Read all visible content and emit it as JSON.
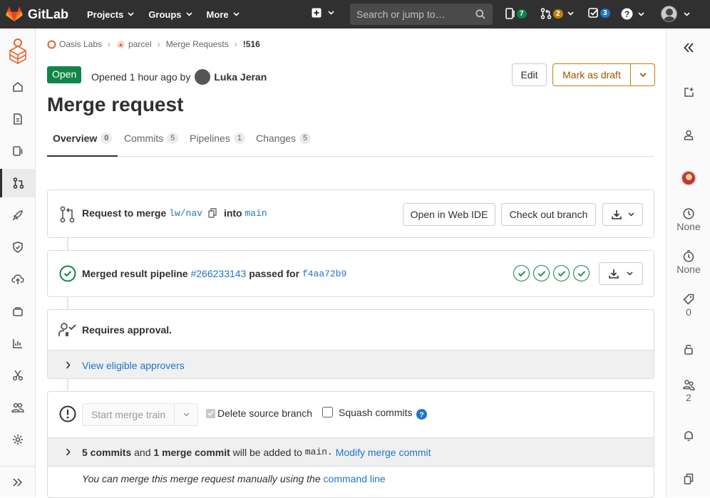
{
  "topbar": {
    "brand": "GitLab",
    "nav": [
      "Projects",
      "Groups",
      "More"
    ],
    "search_placeholder": "Search or jump to…",
    "issues_count": "7",
    "mr_count": "2",
    "todos_count": "3"
  },
  "breadcrumb": [
    "Oasis Labs",
    "parcel",
    "Merge Requests",
    "!516"
  ],
  "header": {
    "status": "Open",
    "opened_text": "Opened 1 hour ago by",
    "author": "Luka Jeran",
    "title": "Merge request",
    "edit_label": "Edit",
    "draft_label": "Mark as draft"
  },
  "tabs": [
    {
      "label": "Overview",
      "count": "0"
    },
    {
      "label": "Commits",
      "count": "5"
    },
    {
      "label": "Pipelines",
      "count": "1"
    },
    {
      "label": "Changes",
      "count": "5"
    }
  ],
  "request": {
    "text": "Request to merge",
    "source": "lw/nav",
    "into": "into",
    "target": "main",
    "web_ide": "Open in Web IDE",
    "checkout": "Check out branch"
  },
  "pipeline": {
    "prefix": "Merged result pipeline",
    "id": "#266233143",
    "passed": "passed for",
    "sha": "f4aa72b9",
    "stages": 4
  },
  "approval": {
    "text": "Requires approval.",
    "view": "View eligible approvers"
  },
  "merge": {
    "button": "Start merge train",
    "delete_source": "Delete source branch",
    "squash": "Squash commits",
    "commits_bold": "5 commits",
    "and": "and",
    "merge_bold": "1 merge commit",
    "added_to": "will be added to",
    "branch": "main.",
    "modify": "Modify merge commit",
    "manual": "You can merge this merge request manually using the",
    "command_line": "command line"
  },
  "right_sidebar": {
    "milestone": "None",
    "time": "None",
    "labels": "0",
    "participants": "2"
  },
  "colors": {
    "topbar": "#303030",
    "success": "#108548",
    "link": "#1f75cb",
    "draft": "#9e5400"
  }
}
